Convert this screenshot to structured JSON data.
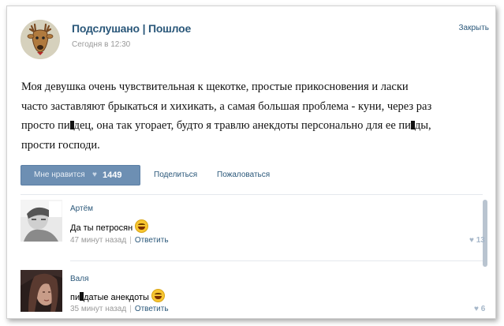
{
  "post": {
    "group_title": "Подслушано | Пошлое",
    "time": "Сегодня в 12:30",
    "close_label": "Закрыть",
    "text_lines": [
      "Моя девушка очень чувствительная к щекотке, простые прикосновения и ласки",
      "часто заставляют брыкаться и хихикать, а самая большая проблема - куни, через раз"
    ],
    "line3_a": "просто пи",
    "line3_b": "дец, она так угорает, будто я травлю анекдоты персонально для ее пи",
    "line3_c": "ды,",
    "line4": "прости господи.",
    "like_label": "Мне нравится",
    "like_count": "1449",
    "share_label": "Поделиться",
    "report_label": "Пожаловаться"
  },
  "comments": [
    {
      "name": "Артём",
      "text": "Да ты петросян",
      "time": "47 минут назад",
      "reply": "Ответить",
      "likes": "13"
    },
    {
      "name": "Валя",
      "text_a": "пи",
      "text_b": "датые анекдоты",
      "time": "35 минут назад",
      "reply": "Ответить",
      "likes": "6"
    }
  ],
  "colors": {
    "link": "#2b587a",
    "like_button": "#6d8fb3",
    "muted": "#999999"
  }
}
